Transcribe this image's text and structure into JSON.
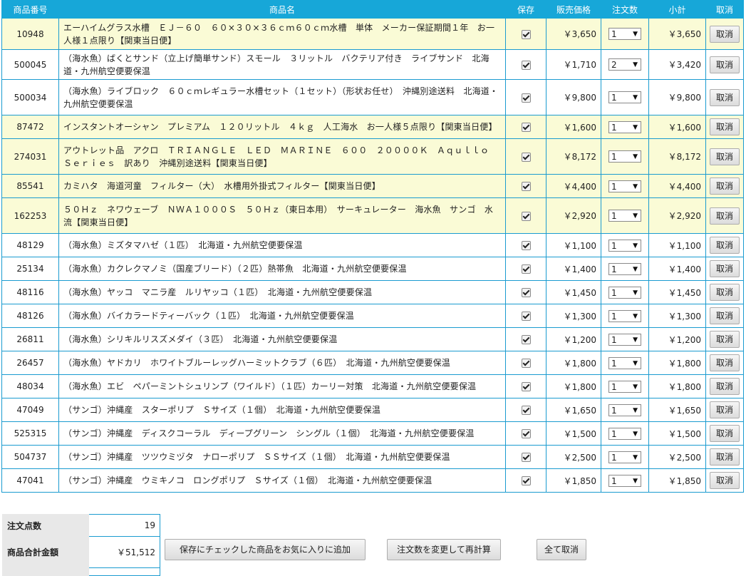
{
  "headers": {
    "code": "商品番号",
    "name": "商品名",
    "keep": "保存",
    "price": "販売価格",
    "qty": "注文数",
    "subtotal": "小計",
    "cancel": "取消"
  },
  "cancel_label": "取消",
  "items": [
    {
      "code": "10948",
      "name": "エーハイムグラス水槽　ＥＪ－６０　６０×３０×３６ｃｍ６０ｃｍ水槽　単体　メーカー保証期間１年　お一人様１点限り【関東当日便】",
      "price": "￥3,650",
      "qty": "1",
      "subtotal": "￥3,650",
      "highlight": true
    },
    {
      "code": "500045",
      "name": "（海水魚）ばくとサンド（立上げ簡単サンド）スモール　３リットル　バクテリア付き　ライブサンド　北海道・九州航空便要保温",
      "price": "￥1,710",
      "qty": "2",
      "subtotal": "￥3,420",
      "highlight": false
    },
    {
      "code": "500034",
      "name": "（海水魚）ライブロック　６０ｃｍレギュラー水槽セット（１セット）（形状お任せ）　沖縄別途送料　北海道・九州航空便要保温",
      "price": "￥9,800",
      "qty": "1",
      "subtotal": "￥9,800",
      "highlight": false
    },
    {
      "code": "87472",
      "name": "インスタントオーシャン　プレミアム　１２０リットル　４ｋｇ　人工海水　お一人様５点限り【関東当日便】",
      "price": "￥1,600",
      "qty": "1",
      "subtotal": "￥1,600",
      "highlight": true
    },
    {
      "code": "274031",
      "name": "アウトレット品　アクロ　ＴＲＩＡＮＧＬＥ　ＬＥＤ　ＭＡＲＩＮＥ　６００　２００００Ｋ　Ａｑｕｌｌｏ　Ｓｅｒｉｅｓ　訳あり　沖縄別途送料【関東当日便】",
      "price": "￥8,172",
      "qty": "1",
      "subtotal": "￥8,172",
      "highlight": true
    },
    {
      "code": "85541",
      "name": "カミハタ　海道河童　フィルター（大）　水槽用外掛式フィルター【関東当日便】",
      "price": "￥4,400",
      "qty": "1",
      "subtotal": "￥4,400",
      "highlight": true
    },
    {
      "code": "162253",
      "name": "５０Ｈｚ　ネワウェーブ　ＮＷＡ１０００Ｓ　５０Ｈｚ（東日本用）　サーキュレーター　海水魚　サンゴ　水流【関東当日便】",
      "price": "￥2,920",
      "qty": "1",
      "subtotal": "￥2,920",
      "highlight": true
    },
    {
      "code": "48129",
      "name": "（海水魚）ミズタマハゼ（１匹）　北海道・九州航空便要保温",
      "price": "￥1,100",
      "qty": "1",
      "subtotal": "￥1,100",
      "highlight": false
    },
    {
      "code": "25134",
      "name": "（海水魚）カクレクマノミ（国産ブリード）（２匹）熱帯魚　北海道・九州航空便要保温",
      "price": "￥1,400",
      "qty": "1",
      "subtotal": "￥1,400",
      "highlight": false
    },
    {
      "code": "48116",
      "name": "（海水魚）ヤッコ　マニラ産　ルリヤッコ（１匹）　北海道・九州航空便要保温",
      "price": "￥1,450",
      "qty": "1",
      "subtotal": "￥1,450",
      "highlight": false
    },
    {
      "code": "48126",
      "name": "（海水魚）バイカラードティーバック（１匹）　北海道・九州航空便要保温",
      "price": "￥1,300",
      "qty": "1",
      "subtotal": "￥1,300",
      "highlight": false
    },
    {
      "code": "26811",
      "name": "（海水魚）シリキルリスズメダイ（３匹）　北海道・九州航空便要保温",
      "price": "￥1,200",
      "qty": "1",
      "subtotal": "￥1,200",
      "highlight": false
    },
    {
      "code": "26457",
      "name": "（海水魚）ヤドカリ　ホワイトブルーレッグハーミットクラブ（６匹）　北海道・九州航空便要保温",
      "price": "￥1,800",
      "qty": "1",
      "subtotal": "￥1,800",
      "highlight": false
    },
    {
      "code": "48034",
      "name": "（海水魚）エビ　ペパーミントシュリンプ（ワイルド）（１匹）カーリー対策　北海道・九州航空便要保温",
      "price": "￥1,800",
      "qty": "1",
      "subtotal": "￥1,800",
      "highlight": false
    },
    {
      "code": "47049",
      "name": "（サンゴ）沖縄産　スターポリプ　Ｓサイズ（１個）　北海道・九州航空便要保温",
      "price": "￥1,650",
      "qty": "1",
      "subtotal": "￥1,650",
      "highlight": false
    },
    {
      "code": "525315",
      "name": "（サンゴ）沖縄産　ディスクコーラル　ディープグリーン　シングル（１個）　北海道・九州航空便要保温",
      "price": "￥1,500",
      "qty": "1",
      "subtotal": "￥1,500",
      "highlight": false
    },
    {
      "code": "504737",
      "name": "（サンゴ）沖縄産　ツツウミヅタ　ナローポリプ　ＳＳサイズ（１個）　北海道・九州航空便要保温",
      "price": "￥2,500",
      "qty": "1",
      "subtotal": "￥2,500",
      "highlight": false
    },
    {
      "code": "47041",
      "name": "（サンゴ）沖縄産　ウミキノコ　ロングポリプ　Ｓサイズ（１個）　北海道・九州航空便要保温",
      "price": "￥1,850",
      "qty": "1",
      "subtotal": "￥1,850",
      "highlight": false
    }
  ],
  "summary": {
    "count_label": "注文点数",
    "count_value": "19",
    "total_label": "商品合計金額",
    "total_value": "￥51,512"
  },
  "actions": {
    "add_favorites": "保存にチェックした商品をお気に入りに追加",
    "recalculate": "注文数を変更して再計算",
    "cancel_all": "全て取消"
  },
  "colors": {
    "header_bg": "#17a7d8",
    "highlight_row": "#fafbd6",
    "border": "#1a9bd0"
  }
}
